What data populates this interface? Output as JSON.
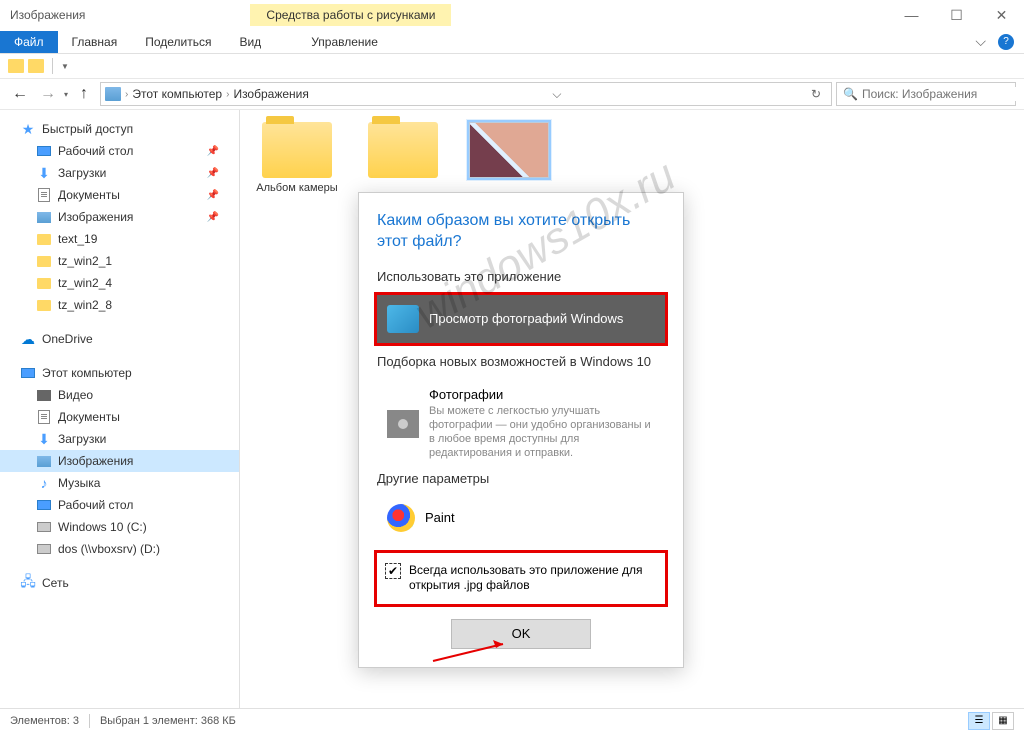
{
  "titlebar": {
    "title": "Изображения",
    "context_tab": "Средства работы с рисунками"
  },
  "ribbon": {
    "file": "Файл",
    "tabs": [
      "Главная",
      "Поделиться",
      "Вид"
    ],
    "manage": "Управление"
  },
  "breadcrumb": {
    "pc": "Этот компьютер",
    "current": "Изображения"
  },
  "search": {
    "placeholder": "Поиск: Изображения"
  },
  "sidebar": {
    "quick_access": "Быстрый доступ",
    "quick_items": [
      {
        "label": "Рабочий стол",
        "pinned": true
      },
      {
        "label": "Загрузки",
        "pinned": true
      },
      {
        "label": "Документы",
        "pinned": true
      },
      {
        "label": "Изображения",
        "pinned": true
      },
      {
        "label": "text_19",
        "pinned": false
      },
      {
        "label": "tz_win2_1",
        "pinned": false
      },
      {
        "label": "tz_win2_4",
        "pinned": false
      },
      {
        "label": "tz_win2_8",
        "pinned": false
      }
    ],
    "onedrive": "OneDrive",
    "this_pc": "Этот компьютер",
    "pc_items": [
      "Видео",
      "Документы",
      "Загрузки",
      "Изображения",
      "Музыка",
      "Рабочий стол",
      "Windows 10 (C:)",
      "dos (\\\\vboxsrv) (D:)"
    ],
    "network": "Сеть"
  },
  "files": {
    "folder1": "Альбом камеры",
    "folder2": "",
    "image1": ""
  },
  "dialog": {
    "title": "Каким образом вы хотите открыть этот файл?",
    "use_app": "Использовать это приложение",
    "photo_viewer": "Просмотр фотографий Windows",
    "promo": "Подборка новых возможностей в Windows 10",
    "photos_app": "Фотографии",
    "photos_desc": "Вы можете с легкостью улучшать фотографии — они удобно организованы и в любое время доступны для редактирования и отправки.",
    "other_params": "Другие параметры",
    "paint": "Paint",
    "always_use": "Всегда использовать это приложение для открытия .jpg файлов",
    "ok": "OK"
  },
  "statusbar": {
    "count": "Элементов: 3",
    "selected": "Выбран 1 элемент: 368 КБ"
  },
  "watermark": "windows10x.ru"
}
